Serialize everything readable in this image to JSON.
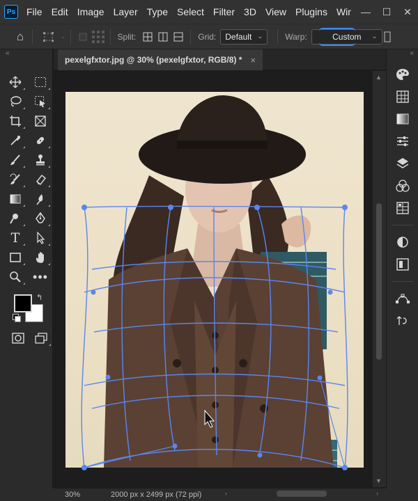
{
  "app": {
    "logo": "Ps",
    "menu": [
      "File",
      "Edit",
      "Image",
      "Layer",
      "Type",
      "Select",
      "Filter",
      "3D",
      "View",
      "Plugins",
      "Windo"
    ]
  },
  "options": {
    "split_label": "Split:",
    "grid_label": "Grid:",
    "grid_value": "Default",
    "warp_label": "Warp:",
    "warp_value": "Custom"
  },
  "document": {
    "tab_title": "pexelgfxtor.jpg @ 30% (pexelgfxtor, RGB/8) *",
    "close": "×"
  },
  "status": {
    "zoom": "30%",
    "doc_info": "2000 px x 2499 px (72 ppi)"
  },
  "colors": {
    "foreground": "#000000",
    "background": "#ffffff",
    "warp_handle": "#5b86ef",
    "accent": "#31a8ff"
  },
  "tools": [
    "move-tool",
    "artboard-tool",
    "lasso-tool",
    "object-select-tool",
    "crop-tool",
    "frame-tool",
    "eyedropper-tool",
    "spot-healing-tool",
    "brush-tool",
    "clone-stamp-tool",
    "history-brush-tool",
    "eraser-tool",
    "gradient-tool",
    "blur-tool",
    "dodge-tool",
    "pen-tool",
    "type-tool",
    "path-select-tool",
    "rectangle-tool",
    "hand-tool",
    "zoom-tool",
    "more-tools"
  ],
  "right_panel_icons": [
    "color-icon",
    "swatches-icon",
    "gradients-icon",
    "adjustments-icon",
    "layers-icon",
    "channels-icon",
    "navigator-icon",
    "properties-icon",
    "libraries-icon",
    "paths-icon",
    "history-icon"
  ]
}
